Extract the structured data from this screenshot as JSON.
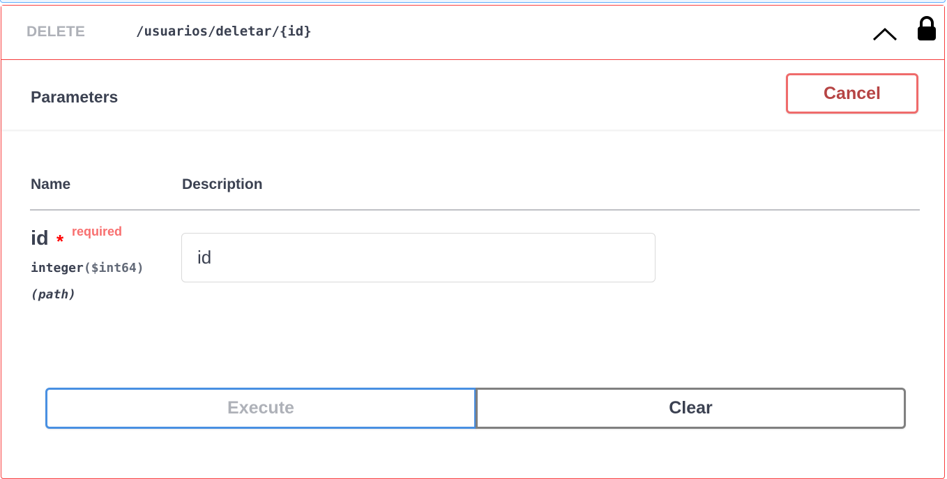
{
  "operation": {
    "method": "DELETE",
    "path": "/usuarios/deletar/{id}"
  },
  "parameters_header": {
    "title": "Parameters",
    "cancel_label": "Cancel"
  },
  "table": {
    "headers": [
      "Name",
      "Description"
    ]
  },
  "parameter": {
    "name": "id",
    "required_star": "*",
    "required_label": "required",
    "type": "integer",
    "format": "($int64)",
    "in": "(path)",
    "input_placeholder": "id",
    "input_value": ""
  },
  "actions": {
    "execute_label": "Execute",
    "clear_label": "Clear"
  },
  "colors": {
    "delete_border": "#f93e3e",
    "cancel_border": "#ef6b6b",
    "execute_border": "#4990e2",
    "required": "#ff0000"
  },
  "icons": [
    "chevron-up-icon",
    "lock-icon"
  ]
}
